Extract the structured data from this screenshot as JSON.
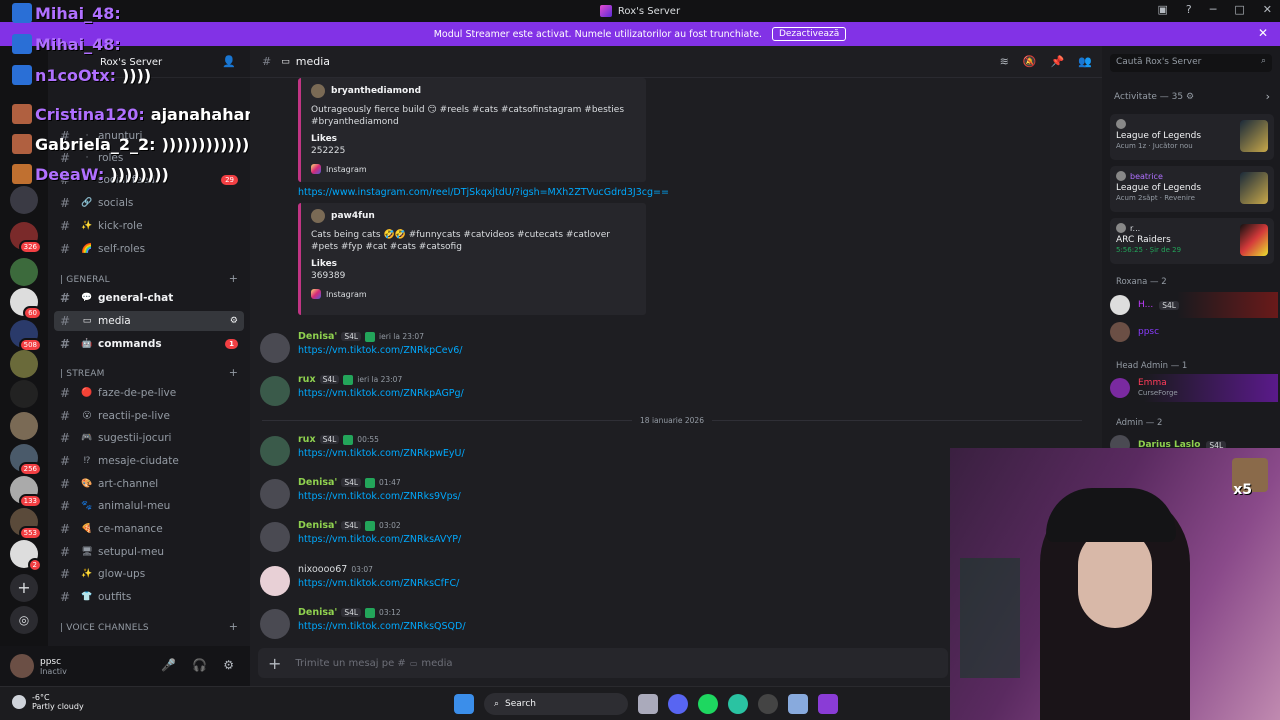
{
  "window": {
    "title": "Rox's Server"
  },
  "banner": {
    "text": "Modul Streamer este activat. Numele utilizatorilor au fost trunchiate.",
    "button": "Dezactivează"
  },
  "server": {
    "name": "Rox's Server"
  },
  "guild_badges": [
    "326",
    "60",
    "508",
    "256",
    "133",
    "553",
    "2"
  ],
  "channels": {
    "top": [
      {
        "label": "anunturi"
      },
      {
        "label": "roles"
      },
      {
        "label": "social-feed",
        "count": "29"
      },
      {
        "label": "socials"
      },
      {
        "label": "kick-role"
      },
      {
        "label": "self-roles"
      }
    ],
    "cat_general": "| GENERAL",
    "general": [
      {
        "label": "general-chat"
      },
      {
        "label": "media"
      },
      {
        "label": "commands",
        "count": "1"
      }
    ],
    "cat_stream": "| STREAM",
    "stream": [
      {
        "label": "faze-de-pe-live"
      },
      {
        "label": "reactii-pe-live"
      },
      {
        "label": "sugestii-jocuri"
      },
      {
        "label": "mesaje-ciudate"
      },
      {
        "label": "art-channel"
      },
      {
        "label": "animalul-meu"
      },
      {
        "label": "ce-manance"
      },
      {
        "label": "setupul-meu"
      },
      {
        "label": "glow-ups"
      },
      {
        "label": "outfits"
      }
    ],
    "cat_voice": "| VOICE CHANNELS"
  },
  "overlay_chat": [
    {
      "name": "Mihai_48:",
      "msg": ""
    },
    {
      "name": "Mihai_48:",
      "msg": ""
    },
    {
      "name": "n1coOtx:",
      "msg": "))))"
    },
    {
      "name": "Cristina120:",
      "msg": "ajanahahanah"
    },
    {
      "name": "Gabriela_2_2:",
      "msg": "))))))))))))))"
    },
    {
      "name": "DeeaW:",
      "msg": "))))))))"
    }
  ],
  "user": {
    "name": "ppsc",
    "status": "Inactiv"
  },
  "channel_header": {
    "name": "media"
  },
  "search_placeholder": "Caută Rox's Server",
  "embeds": [
    {
      "author": "bryanthediamond",
      "desc": "Outrageously fierce build 😏 #reels #cats #catsofinstagram #besties #bryanthediamond",
      "field": "Likes",
      "value": "252225",
      "footer": "Instagram"
    },
    {
      "author": "paw4fun",
      "desc": "Cats being cats 🤣🤣 #funnycats #catvideos #cutecats #catlover #pets #fyp #cat #cats #catsofig",
      "field": "Likes",
      "value": "369389",
      "footer": "Instagram"
    }
  ],
  "embed_link": "https://www.instagram.com/reel/DTjSkqxjtdU/?igsh=MXh2ZTVucGdrd3J3cg==",
  "messages_before": [
    {
      "user": "Denisa'",
      "tag": "S4L",
      "time": "ieri la 23:07",
      "text": "https://vm.tiktok.com/ZNRkpCev6/",
      "color": "#8fd14f"
    },
    {
      "user": "rux",
      "tag": "S4L",
      "time": "ieri la 23:07",
      "text": "https://vm.tiktok.com/ZNRkpAGPg/",
      "color": "#8fd14f"
    }
  ],
  "date_divider": "18 ianuarie 2026",
  "messages_after": [
    {
      "user": "rux",
      "tag": "S4L",
      "time": "00:55",
      "text": "https://vm.tiktok.com/ZNRkpwEyU/",
      "color": "#8fd14f"
    },
    {
      "user": "Denisa'",
      "tag": "S4L",
      "time": "01:47",
      "text": "https://vm.tiktok.com/ZNRks9Vps/",
      "color": "#8fd14f"
    },
    {
      "user": "Denisa'",
      "tag": "S4L",
      "time": "03:02",
      "text": "https://vm.tiktok.com/ZNRksAVYP/",
      "color": "#8fd14f"
    },
    {
      "user": "nixoooo67",
      "tag": "",
      "time": "03:07",
      "text": "https://vm.tiktok.com/ZNRksCfFC/",
      "color": "#dbdee1"
    },
    {
      "user": "Denisa'",
      "tag": "S4L",
      "time": "03:12",
      "text": "https://vm.tiktok.com/ZNRksQSQD/",
      "color": "#8fd14f"
    }
  ],
  "compose_placeholder": "Trimite un mesaj pe #",
  "compose_channel": "media",
  "activity": {
    "header": "Activitate — 35",
    "cards": [
      {
        "user": "",
        "game": "League of Legends",
        "meta": "Acum 1z · Jucător nou"
      },
      {
        "user": "beatrice",
        "game": "League of Legends",
        "meta": "Acum 2săpt · Revenire"
      },
      {
        "user": "r...",
        "game": "ARC Raiders",
        "meta": "5:56:25 · Șir de 29"
      }
    ]
  },
  "roles": [
    {
      "label": "Roxana — 2"
    },
    {
      "label": "Head Admin — 1"
    },
    {
      "label": "Admin — 2"
    }
  ],
  "members": [
    {
      "name": "H...",
      "tag": "S4L",
      "color": "#c03cff"
    },
    {
      "name": "ppsc",
      "tag": "",
      "color": "#8a3cff"
    },
    {
      "name": "Emma",
      "tag": "",
      "sub": "CurseForge",
      "color": "#ff3c5a"
    },
    {
      "name": "Darius Laslo",
      "tag": "S4L",
      "color": "#8fd14f"
    }
  ],
  "webcam": {
    "label": "x5"
  },
  "taskbar": {
    "temp": "-6°C",
    "weather": "Partly cloudy",
    "search": "Search"
  }
}
